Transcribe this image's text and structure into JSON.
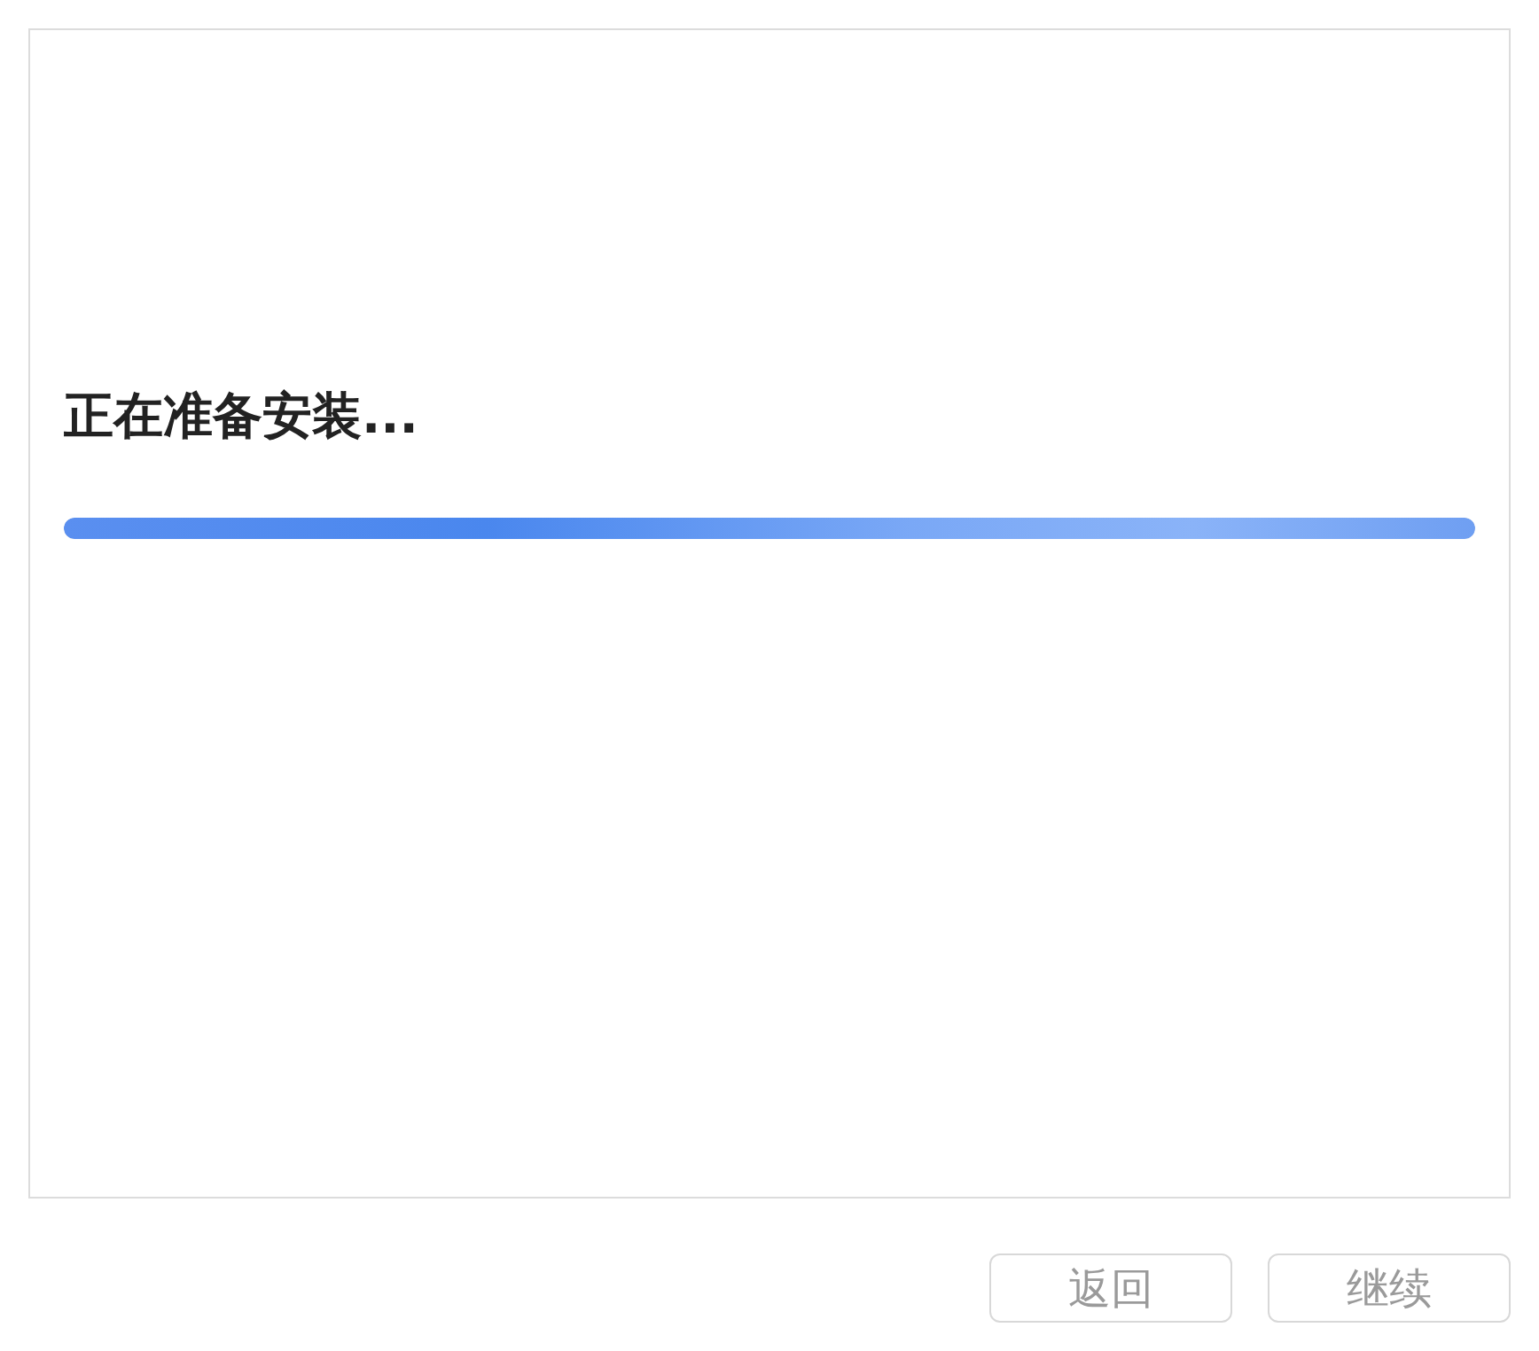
{
  "status": {
    "title": "正在准备安装...",
    "progress": {
      "level": 1
    }
  },
  "buttons": [
    {
      "label": "返回",
      "disabled": true
    },
    {
      "label": "继续",
      "disabled": true
    }
  ]
}
